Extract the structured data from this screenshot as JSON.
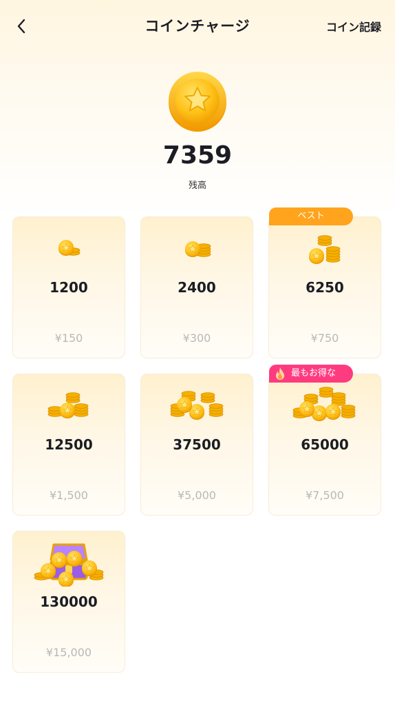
{
  "header": {
    "title": "コインチャージ",
    "records_label": "コイン記録",
    "back_icon": "chevron-left-icon"
  },
  "balance": {
    "value": "7359",
    "label": "残高",
    "icon": "star-coin-icon"
  },
  "packages": [
    {
      "coins": "1200",
      "price": "¥150",
      "icon": "single-coin-icon"
    },
    {
      "coins": "2400",
      "price": "¥300",
      "icon": "two-coins-icon"
    },
    {
      "coins": "6250",
      "price": "¥750",
      "icon": "coin-stack-icon",
      "badge": "ベスト"
    },
    {
      "coins": "12500",
      "price": "¥1,500",
      "icon": "coin-pile-icon"
    },
    {
      "coins": "37500",
      "price": "¥5,000",
      "icon": "coin-pile-large-icon"
    },
    {
      "coins": "65000",
      "price": "¥7,500",
      "icon": "coin-heap-icon",
      "badge": "最もお得な"
    },
    {
      "coins": "130000",
      "price": "¥15,000",
      "icon": "treasure-chest-icon"
    }
  ],
  "colors": {
    "coin_gold": "#ffc21a",
    "badge_best": "#ffa41c",
    "badge_deal": "#ff3b7f",
    "price_text": "#b8b8b8"
  }
}
